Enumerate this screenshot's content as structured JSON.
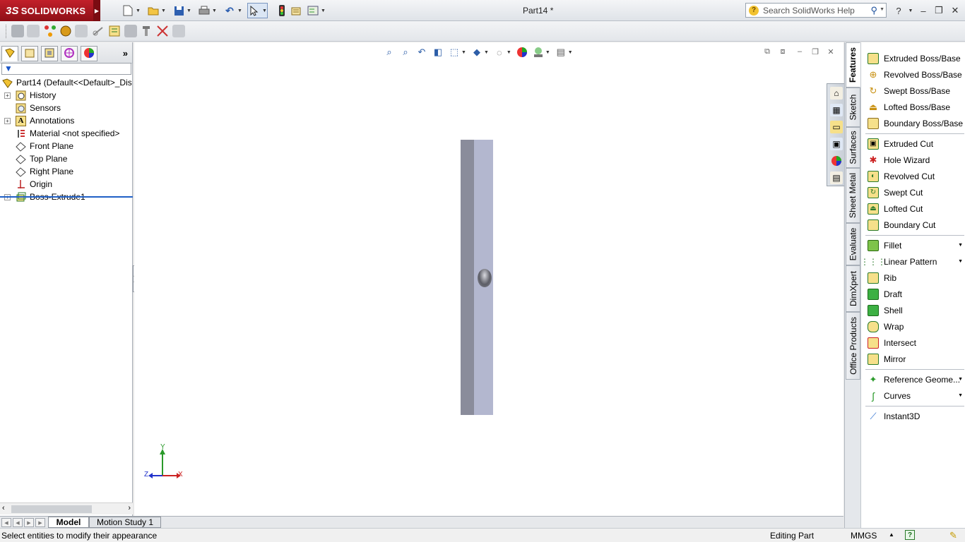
{
  "app": {
    "logo_ds": "3S",
    "logo_text": "SOLIDWORKS",
    "document_title": "Part14 *"
  },
  "quick_access": {
    "new": "new-document-icon",
    "open": "open-icon",
    "save": "save-icon",
    "print": "print-icon",
    "undo": "undo-icon",
    "select": "select-icon",
    "rebuild": "rebuild-icon",
    "file_properties": "file-properties-icon",
    "options": "options-icon"
  },
  "search": {
    "placeholder": "Search SolidWorks Help"
  },
  "feature_tree": {
    "root": "Part14  (Default<<Default>_Dis",
    "items": [
      {
        "label": "History",
        "icon": "history-icon",
        "expandable": true
      },
      {
        "label": "Sensors",
        "icon": "sensors-icon",
        "expandable": false
      },
      {
        "label": "Annotations",
        "icon": "annotations-icon",
        "expandable": true
      },
      {
        "label": "Material <not specified>",
        "icon": "material-icon",
        "expandable": false
      },
      {
        "label": "Front Plane",
        "icon": "plane-icon",
        "expandable": false
      },
      {
        "label": "Top Plane",
        "icon": "plane-icon",
        "expandable": false
      },
      {
        "label": "Right Plane",
        "icon": "plane-icon",
        "expandable": false
      },
      {
        "label": "Origin",
        "icon": "origin-icon",
        "expandable": false
      },
      {
        "label": "Boss-Extrude1",
        "icon": "extrude-icon",
        "expandable": true
      }
    ]
  },
  "command_tabs": [
    "Features",
    "Sketch",
    "Surfaces",
    "Sheet Metal",
    "Evaluate",
    "DimXpert",
    "Office Products"
  ],
  "active_command_tab": "Features",
  "features": {
    "group1": [
      "Extruded Boss/Base",
      "Revolved Boss/Base",
      "Swept Boss/Base",
      "Lofted Boss/Base",
      "Boundary Boss/Base"
    ],
    "group2": [
      "Extruded Cut",
      "Hole Wizard",
      "Revolved Cut",
      "Swept Cut",
      "Lofted Cut",
      "Boundary Cut"
    ],
    "group3": [
      "Fillet",
      "Linear Pattern",
      "Rib",
      "Draft",
      "Shell",
      "Wrap",
      "Intersect",
      "Mirror"
    ],
    "group4": [
      "Reference Geome...",
      "Curves"
    ],
    "group5": [
      "Instant3D"
    ]
  },
  "triad": {
    "y": "Y",
    "x": "X",
    "z": "Z"
  },
  "bottom_tabs": {
    "model": "Model",
    "motion": "Motion Study 1"
  },
  "status": {
    "message": "Select entities to modify their appearance",
    "mode": "Editing Part",
    "units": "MMGS"
  },
  "colors": {
    "brand_red": "#b01820",
    "part_dark": "#8a8c9b",
    "part_light": "#b3b7cf",
    "selection_blue": "#1f5fc6"
  }
}
